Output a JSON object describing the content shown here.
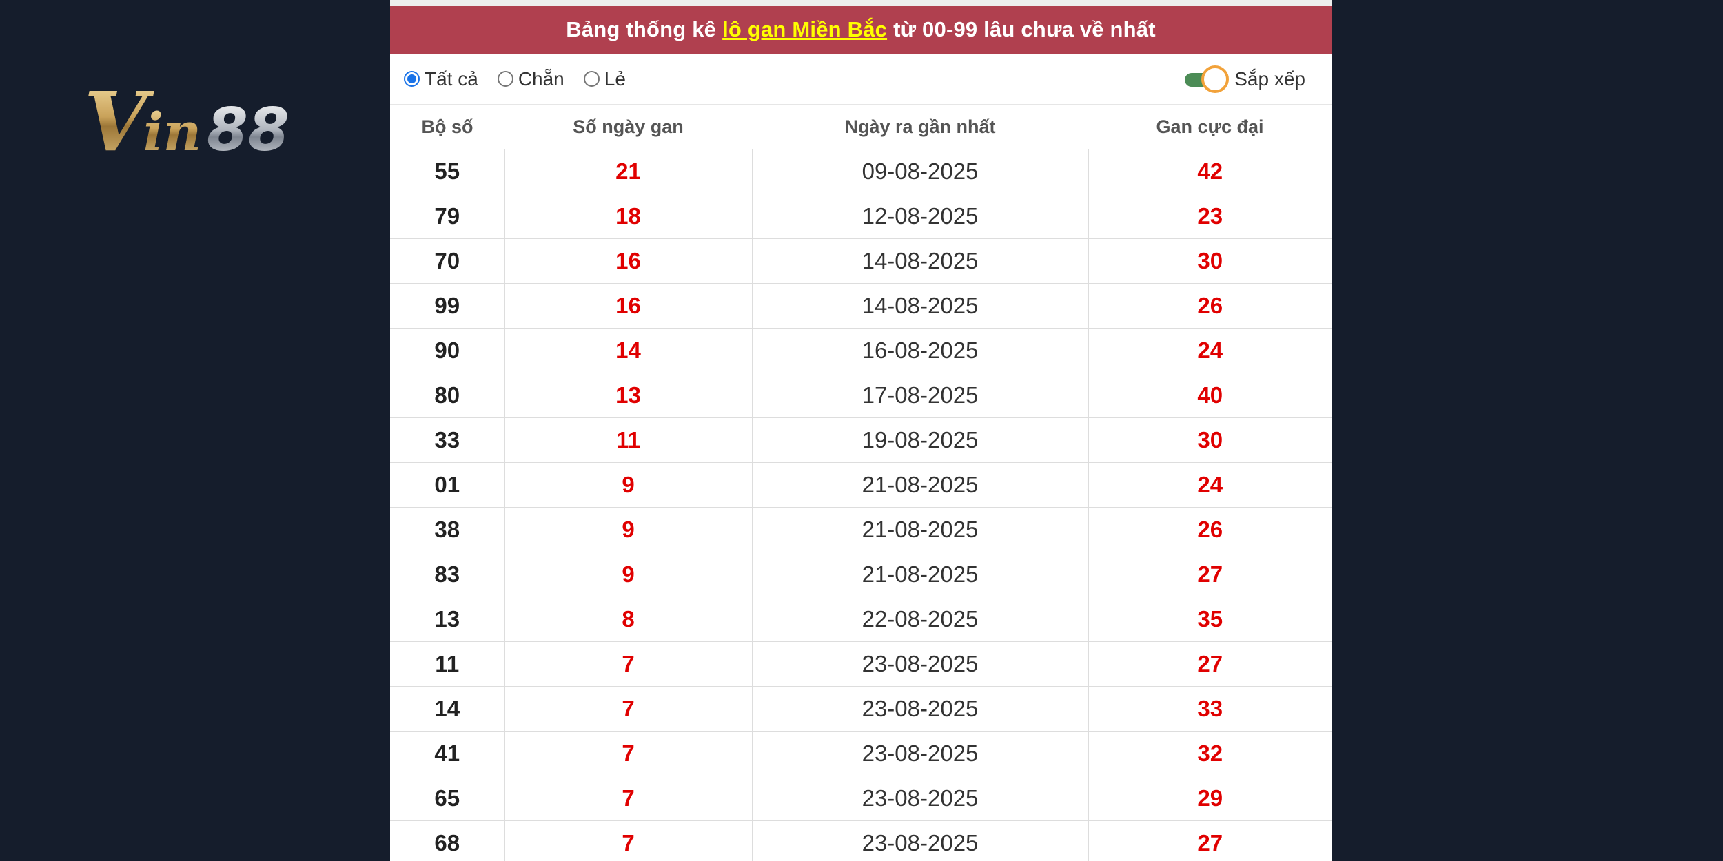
{
  "logo": {
    "text": "Vin88"
  },
  "title": {
    "prefix": "Bảng thống kê",
    "highlight": "lô gan Miền Bắc",
    "suffix": "từ 00-99 lâu chưa về nhất"
  },
  "filters": {
    "options": [
      "Tất cả",
      "Chẵn",
      "Lẻ"
    ],
    "selected": "Tất cả",
    "sort_label": "Sắp xếp"
  },
  "table": {
    "headers": [
      "Bộ số",
      "Số ngày gan",
      "Ngày ra gần nhất",
      "Gan cực đại"
    ],
    "rows": [
      [
        "55",
        "21",
        "09-08-2025",
        "42"
      ],
      [
        "79",
        "18",
        "12-08-2025",
        "23"
      ],
      [
        "70",
        "16",
        "14-08-2025",
        "30"
      ],
      [
        "99",
        "16",
        "14-08-2025",
        "26"
      ],
      [
        "90",
        "14",
        "16-08-2025",
        "24"
      ],
      [
        "80",
        "13",
        "17-08-2025",
        "40"
      ],
      [
        "33",
        "11",
        "19-08-2025",
        "30"
      ],
      [
        "01",
        "9",
        "21-08-2025",
        "24"
      ],
      [
        "38",
        "9",
        "21-08-2025",
        "26"
      ],
      [
        "83",
        "9",
        "21-08-2025",
        "27"
      ],
      [
        "13",
        "8",
        "22-08-2025",
        "35"
      ],
      [
        "11",
        "7",
        "23-08-2025",
        "27"
      ],
      [
        "14",
        "7",
        "23-08-2025",
        "33"
      ],
      [
        "41",
        "7",
        "23-08-2025",
        "32"
      ],
      [
        "65",
        "7",
        "23-08-2025",
        "29"
      ],
      [
        "68",
        "7",
        "23-08-2025",
        "27"
      ]
    ]
  },
  "colors": {
    "background": "#151d2c",
    "title_bar": "#b0404f",
    "highlight": "#ffff00",
    "value_red": "#e00000",
    "radio_accent": "#1a73e8",
    "toggle_track": "#4c8c56",
    "toggle_knob_border": "#f2a23a"
  }
}
